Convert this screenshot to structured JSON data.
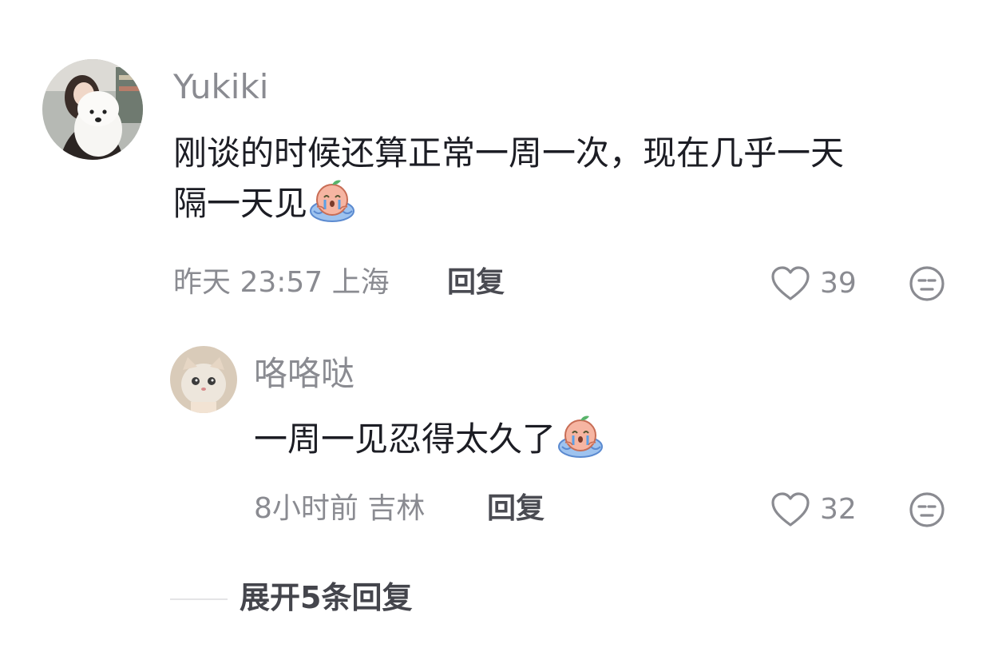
{
  "comment": {
    "username": "Yukiki",
    "text_line1": "刚谈的时候还算正常一周一次，现在几乎一天",
    "text_line2": "隔一天见",
    "emoji": "crying-emoji",
    "time": "昨天 23:57",
    "location": "上海",
    "reply_label": "回复",
    "like_count": "39"
  },
  "reply": {
    "username": "咯咯哒",
    "text": "一周一见忍得太久了",
    "emoji": "crying-emoji",
    "time": "8小时前",
    "location": "吉林",
    "reply_label": "回复",
    "like_count": "32"
  },
  "expand_replies_label": "展开5条回复",
  "icons": [
    "heart-icon",
    "dislike-face-icon",
    "crying-emoji"
  ],
  "colors": {
    "primary_text": "#1c1d24",
    "secondary_text": "#8a8b91",
    "reply_button": "#4a4b52",
    "divider": "#e4e4e6"
  }
}
